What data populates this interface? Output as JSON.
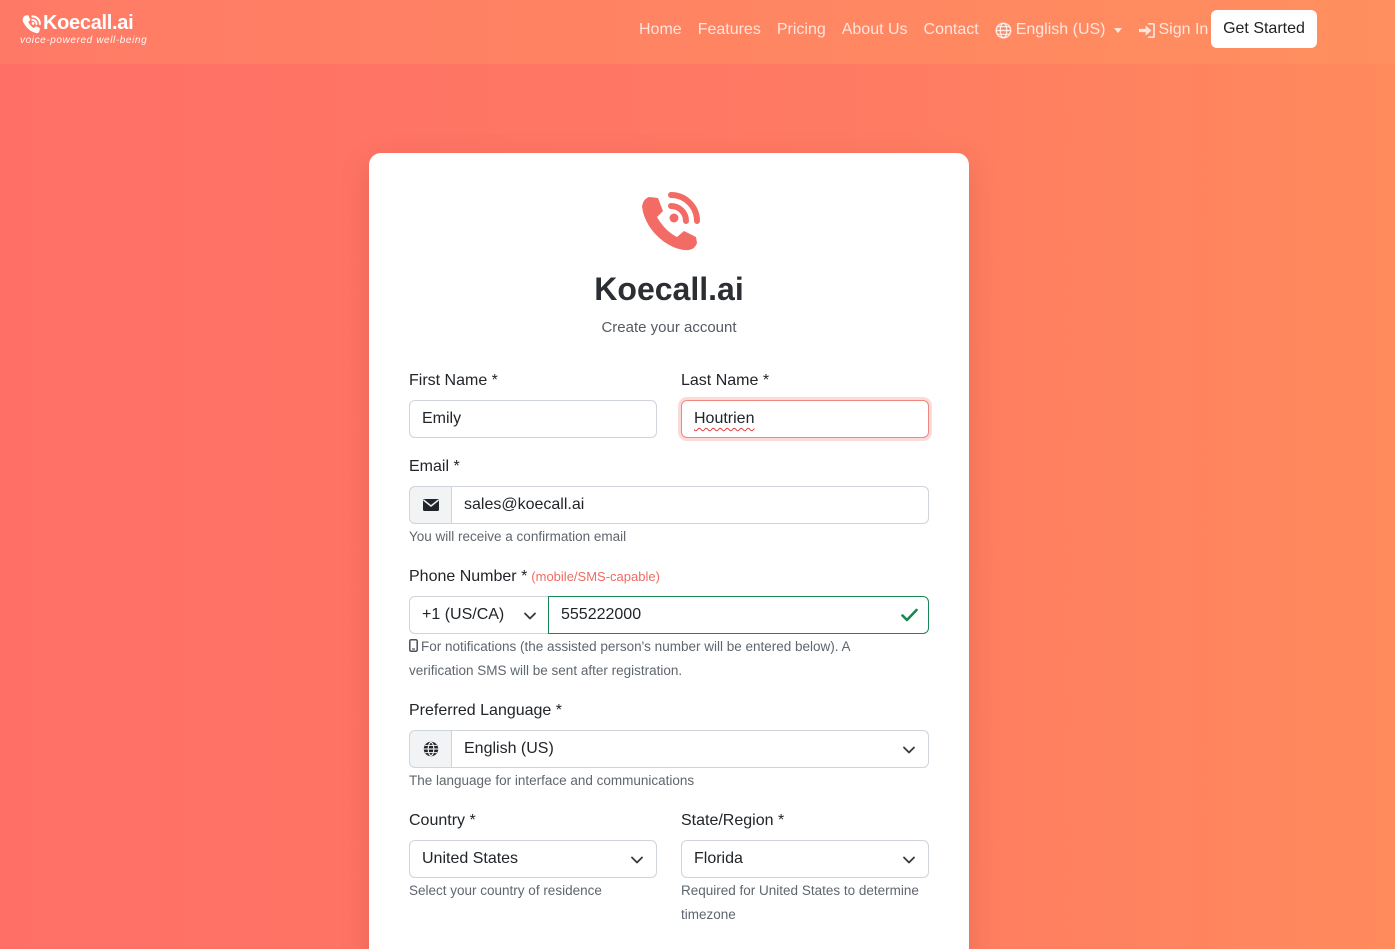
{
  "nav": {
    "brand_name": "Koecall.ai",
    "brand_tagline": "voice-powered well-being",
    "links": [
      "Home",
      "Features",
      "Pricing",
      "About Us",
      "Contact"
    ],
    "language": "English (US)",
    "sign_in": "Sign In",
    "get_started": "Get Started"
  },
  "card": {
    "title": "Koecall.ai",
    "subtitle": "Create your account"
  },
  "form": {
    "first_name": {
      "label": "First Name *",
      "value": "Emily"
    },
    "last_name": {
      "label": "Last Name *",
      "value": "Houtrien"
    },
    "email": {
      "label": "Email *",
      "value": "sales@koecall.ai",
      "help": "You will receive a confirmation email"
    },
    "phone": {
      "label": "Phone Number *",
      "note": "(mobile/SMS-capable)",
      "country_code": "+1 (US/CA)",
      "value": "555222000",
      "help": "For notifications (the assisted person's number will be entered below). A verification SMS will be sent after registration."
    },
    "language": {
      "label": "Preferred Language *",
      "value": "English (US)",
      "help": "The language for interface and communications"
    },
    "country": {
      "label": "Country *",
      "value": "United States",
      "help": "Select your country of residence"
    },
    "state": {
      "label": "State/Region *",
      "value": "Florida",
      "help": "Required for United States to determine timezone"
    }
  },
  "colors": {
    "accent": "#f26b64",
    "valid": "#198754",
    "nav_bg": "#ff8a62"
  },
  "icons": {
    "brand": "phone-wave-icon",
    "globe": "globe-icon",
    "sign_in": "sign-in-icon",
    "envelope": "envelope-icon",
    "mobile": "mobile-icon",
    "check": "check-icon",
    "chevron": "chevron-down-icon"
  }
}
